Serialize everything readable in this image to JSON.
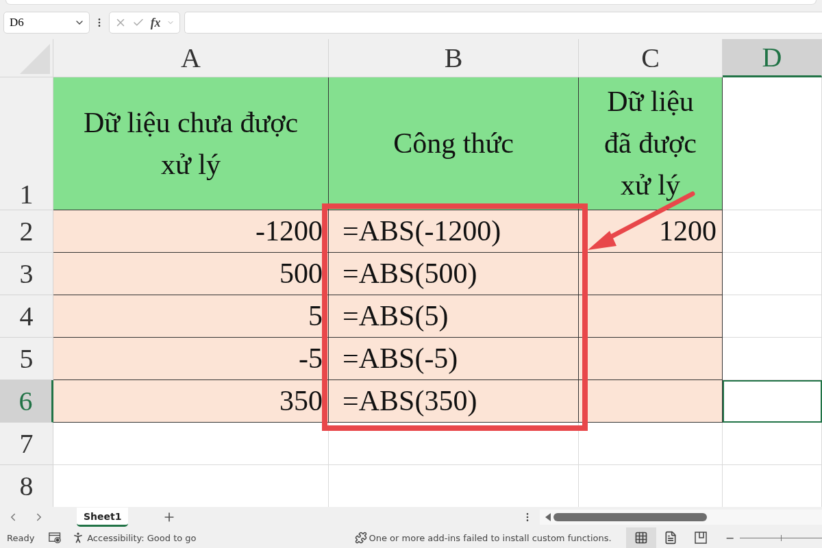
{
  "formula_bar": {
    "name_box": "D6",
    "function_label": "fx"
  },
  "columns": [
    {
      "label": "A",
      "selected": false
    },
    {
      "label": "B",
      "selected": false
    },
    {
      "label": "C",
      "selected": false
    },
    {
      "label": "D",
      "selected": true
    }
  ],
  "rows": [
    {
      "label": "1",
      "selected": false,
      "cells": [
        {
          "kind": "heading",
          "text": "Dữ liệu chưa được xử lý",
          "selected": false
        },
        {
          "kind": "heading",
          "text": "Công thức",
          "selected": false
        },
        {
          "kind": "heading",
          "text": "Dữ liệu đã được xử lý",
          "selected": false
        },
        {
          "kind": "empty",
          "selected": false
        }
      ]
    },
    {
      "label": "2",
      "selected": false,
      "cells": [
        {
          "kind": "number",
          "text": "-1200",
          "selected": false
        },
        {
          "kind": "text",
          "text": "=ABS(-1200)",
          "selected": false
        },
        {
          "kind": "number",
          "text": "1200",
          "selected": false
        },
        {
          "kind": "empty",
          "selected": false
        }
      ]
    },
    {
      "label": "3",
      "selected": false,
      "cells": [
        {
          "kind": "number",
          "text": "500",
          "selected": false
        },
        {
          "kind": "text",
          "text": "=ABS(500)",
          "selected": false
        },
        {
          "kind": "filled",
          "selected": false
        },
        {
          "kind": "empty",
          "selected": false
        }
      ]
    },
    {
      "label": "4",
      "selected": false,
      "cells": [
        {
          "kind": "number",
          "text": "5",
          "selected": false
        },
        {
          "kind": "text",
          "text": "=ABS(5)",
          "selected": false
        },
        {
          "kind": "filled",
          "selected": false
        },
        {
          "kind": "empty",
          "selected": false
        }
      ]
    },
    {
      "label": "5",
      "selected": false,
      "cells": [
        {
          "kind": "number",
          "text": "-5",
          "selected": false
        },
        {
          "kind": "text",
          "text": "=ABS(-5)",
          "selected": false
        },
        {
          "kind": "filled",
          "selected": false
        },
        {
          "kind": "empty",
          "selected": false
        }
      ]
    },
    {
      "label": "6",
      "selected": true,
      "cells": [
        {
          "kind": "number",
          "text": "350",
          "selected": false
        },
        {
          "kind": "text",
          "text": "=ABS(350)",
          "selected": false
        },
        {
          "kind": "filled",
          "selected": false
        },
        {
          "kind": "empty",
          "selected": true
        }
      ]
    },
    {
      "label": "7",
      "selected": false,
      "cells": [
        {
          "kind": "empty",
          "selected": false
        },
        {
          "kind": "empty",
          "selected": false
        },
        {
          "kind": "empty",
          "selected": false
        },
        {
          "kind": "empty",
          "selected": false
        }
      ]
    },
    {
      "label": "8",
      "selected": false,
      "cells": [
        {
          "kind": "empty",
          "selected": false
        },
        {
          "kind": "empty",
          "selected": false
        },
        {
          "kind": "empty",
          "selected": false
        },
        {
          "kind": "empty",
          "selected": false
        }
      ]
    }
  ],
  "sheet_tabs": [
    {
      "label": "Sheet1",
      "selected": true
    }
  ],
  "status_bar": {
    "mode": "Ready",
    "accessibility": "Accessibility: Good to go",
    "message": "One or more add-ins failed to install custom functions.",
    "views": [
      {
        "kind": "normal",
        "selected": true
      },
      {
        "kind": "page_layout",
        "selected": false
      },
      {
        "kind": "page_break",
        "selected": false
      }
    ],
    "zoom_out": "−",
    "zoom": {
      "level": 0.5
    }
  }
}
